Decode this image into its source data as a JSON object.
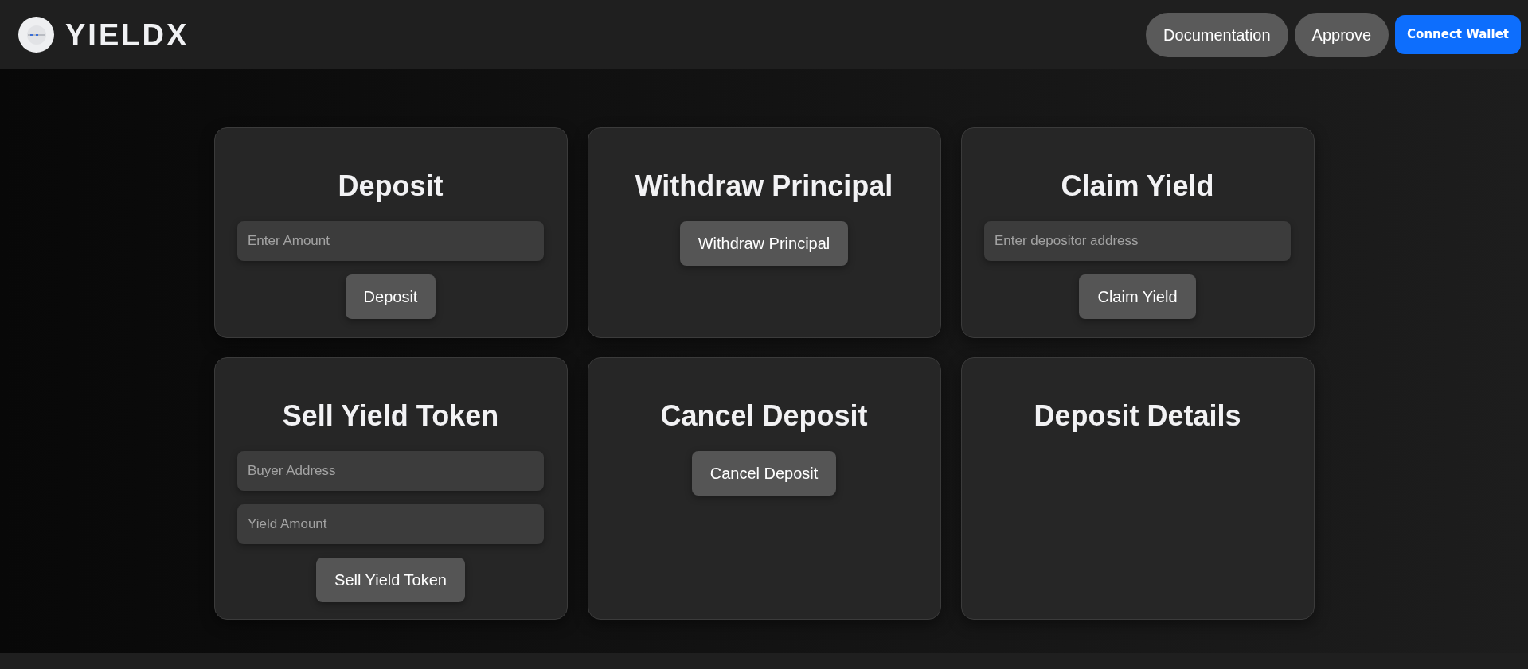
{
  "header": {
    "brand": "YIELDX",
    "buttons": [
      {
        "label": "Documentation",
        "kind": "pill"
      },
      {
        "label": "Approve",
        "kind": "pill"
      },
      {
        "label": "Connect Wallet",
        "kind": "primary"
      }
    ]
  },
  "cards": [
    {
      "title": "Deposit",
      "fields": [
        {
          "placeholder": "Enter Amount"
        }
      ],
      "button": "Deposit"
    },
    {
      "title": "Withdraw Principal",
      "button": "Withdraw Principal"
    },
    {
      "title": "Claim Yield",
      "fields": [
        {
          "placeholder": "Enter depositor address"
        }
      ],
      "button": "Claim Yield"
    },
    {
      "title": "Sell Yield Token",
      "fields": [
        {
          "placeholder": "Buyer Address"
        },
        {
          "placeholder": "Yield Amount"
        }
      ],
      "button": "Sell Yield Token"
    },
    {
      "title": "Cancel Deposit",
      "button": "Cancel Deposit"
    },
    {
      "title": "Deposit Details"
    }
  ]
}
